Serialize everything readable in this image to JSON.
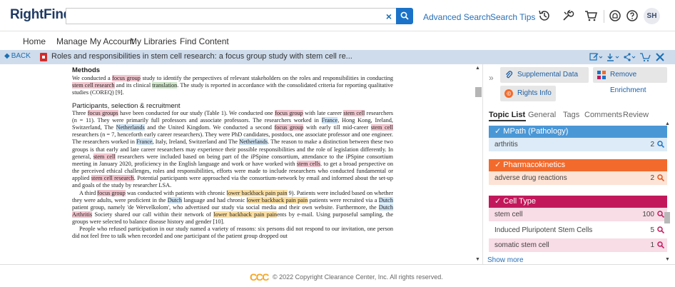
{
  "app": {
    "logo": "RightFind"
  },
  "search": {
    "value": "",
    "placeholder": "",
    "clear_icon": "×"
  },
  "top_links": {
    "advanced": "Advanced Search",
    "tips": "Search Tips"
  },
  "user": {
    "initials": "SH"
  },
  "nav": [
    "Home",
    "Manage My Account",
    "My Libraries",
    "Find Content"
  ],
  "document": {
    "back_label": "BACK",
    "title": "Roles and responsibilities in stem cell research: a focus group study with stem cell re..."
  },
  "article": {
    "methods_heading": "Methods",
    "methods_text": [
      {
        "t": "We conducted a "
      },
      {
        "t": "focus group",
        "h": "red"
      },
      {
        "t": " study to identify the perspectives of relevant stakeholders on the roles and responsibilities in conducting "
      },
      {
        "t": "stem cell research",
        "h": "red"
      },
      {
        "t": " and its clinical "
      },
      {
        "t": "translation",
        "h": "green"
      },
      {
        "t": ". The study is reported in accordance with the consolidated criteria for reporting qualitative studies (COREQ) [9]."
      }
    ],
    "participants_heading": "Participants, selection & recruitment",
    "para1": [
      {
        "t": "Three "
      },
      {
        "t": "focus groups",
        "h": "red"
      },
      {
        "t": " have been conducted for our study (Table 1). We conducted one "
      },
      {
        "t": "focus group",
        "h": "red"
      },
      {
        "t": " with late career "
      },
      {
        "t": "stem cell",
        "h": "red"
      },
      {
        "t": " researchers (n = 11). They were primarily full professors and associate professors. The researchers worked in "
      },
      {
        "t": "France",
        "h": "blue"
      },
      {
        "t": ", Hong Kong, Ireland, Switzerland, The "
      },
      {
        "t": "Netherlands",
        "h": "blue"
      },
      {
        "t": " and the United Kingdom. We conducted a second "
      },
      {
        "t": "focus group",
        "h": "red"
      },
      {
        "t": " with early till mid-career "
      },
      {
        "t": "stem cell",
        "h": "red"
      },
      {
        "t": " researchers (n = 7, henceforth early career researchers). They were PhD candidates, postdocs, one associate professor and one engineer. The researchers worked in "
      },
      {
        "t": "France",
        "h": "blue"
      },
      {
        "t": ", Italy, Ireland, Switzerland and The "
      },
      {
        "t": "Netherlands",
        "h": "blue"
      },
      {
        "t": ". The reason to make a distinction between these two groups is that early and late career researchers may experience their possible responsibilities and the role of legislation differently. In general, "
      },
      {
        "t": "stem cell",
        "h": "red"
      },
      {
        "t": " researchers were included based on being part of the iPSpine consortium, attendance to the iPSpine consortium meeting in January 2020, proficiency in the English language and work or have worked with "
      },
      {
        "t": "stem cells",
        "h": "red"
      },
      {
        "t": ". to get a broad perspective on the perceived ethical challenges, roles and responsibilities, efforts were made to include researchers who conducted fundamental or applied "
      },
      {
        "t": "stem cell research",
        "h": "red"
      },
      {
        "t": ". Potential participants were approached via the consortium-network by email and informed about the set-up and goals of the study by researcher LSA."
      }
    ],
    "para2": [
      {
        "t": "A third "
      },
      {
        "t": "focus group",
        "h": "red"
      },
      {
        "t": " was conducted with patients with chronic "
      },
      {
        "t": "lower backback pain pain",
        "h": "orange"
      },
      {
        "t": " 9). Patients were included based on whether they were adults, were proficient in the "
      },
      {
        "t": "Dutch",
        "h": "blue"
      },
      {
        "t": " language and had chronic "
      },
      {
        "t": "lower backback pain pain",
        "h": "orange"
      },
      {
        "t": " patients were recruited via a "
      },
      {
        "t": "Dutch",
        "h": "blue"
      },
      {
        "t": " patient group, namely 'de Wervelkolom', who advertised our study via social media and their own website. Furthermore, the "
      },
      {
        "t": "Dutch",
        "h": "blue"
      },
      {
        "t": " "
      },
      {
        "t": "Arthritis",
        "h": "red"
      },
      {
        "t": " Society shared our call within their network of "
      },
      {
        "t": "lower backback pain pain",
        "h": "orange"
      },
      {
        "t": "ents by e-mail. Using purposeful sampling, the groups were selected to balance disease history and gender [10]."
      }
    ],
    "para3": [
      {
        "t": "People who refused participation in our study named a variety of reasons: six persons did not respond to our invitation, one person did not feel free to talk when recorded and one participant of the patient group dropped out"
      }
    ]
  },
  "panel": {
    "supplemental": "Supplemental Data",
    "remove_enrichment": "Remove Enrichment",
    "rights_info": "Rights Info",
    "tabs": [
      "Topic List",
      "General",
      "Tags",
      "Comments",
      "Review"
    ],
    "groups": [
      {
        "name": "MPath (Pathology)",
        "color": "#4a97d6",
        "row_bg": "#dcebf7",
        "icon_color": "#1a73c9",
        "items": [
          {
            "label": "arthritis",
            "count": "2"
          }
        ]
      },
      {
        "name": "Pharmacokinetics",
        "color": "#f26a2c",
        "row_bg": "#fde3d5",
        "icon_color": "#e0531a",
        "items": [
          {
            "label": "adverse drug reactions",
            "count": "2"
          }
        ]
      },
      {
        "name": "Cell Type",
        "color": "#c2185b",
        "row_bg": "#f8dce6",
        "icon_color": "#c2185b",
        "items": [
          {
            "label": "stem cell",
            "count": "100"
          },
          {
            "label": "Induced Pluripotent Stem Cells",
            "count": "5"
          },
          {
            "label": "somatic stem cell",
            "count": "1"
          }
        ]
      }
    ],
    "show_more": "Show more"
  },
  "footer": {
    "logo": "CCC",
    "copyright": "© 2022 Copyright Clearance Center, Inc. All rights reserved."
  }
}
